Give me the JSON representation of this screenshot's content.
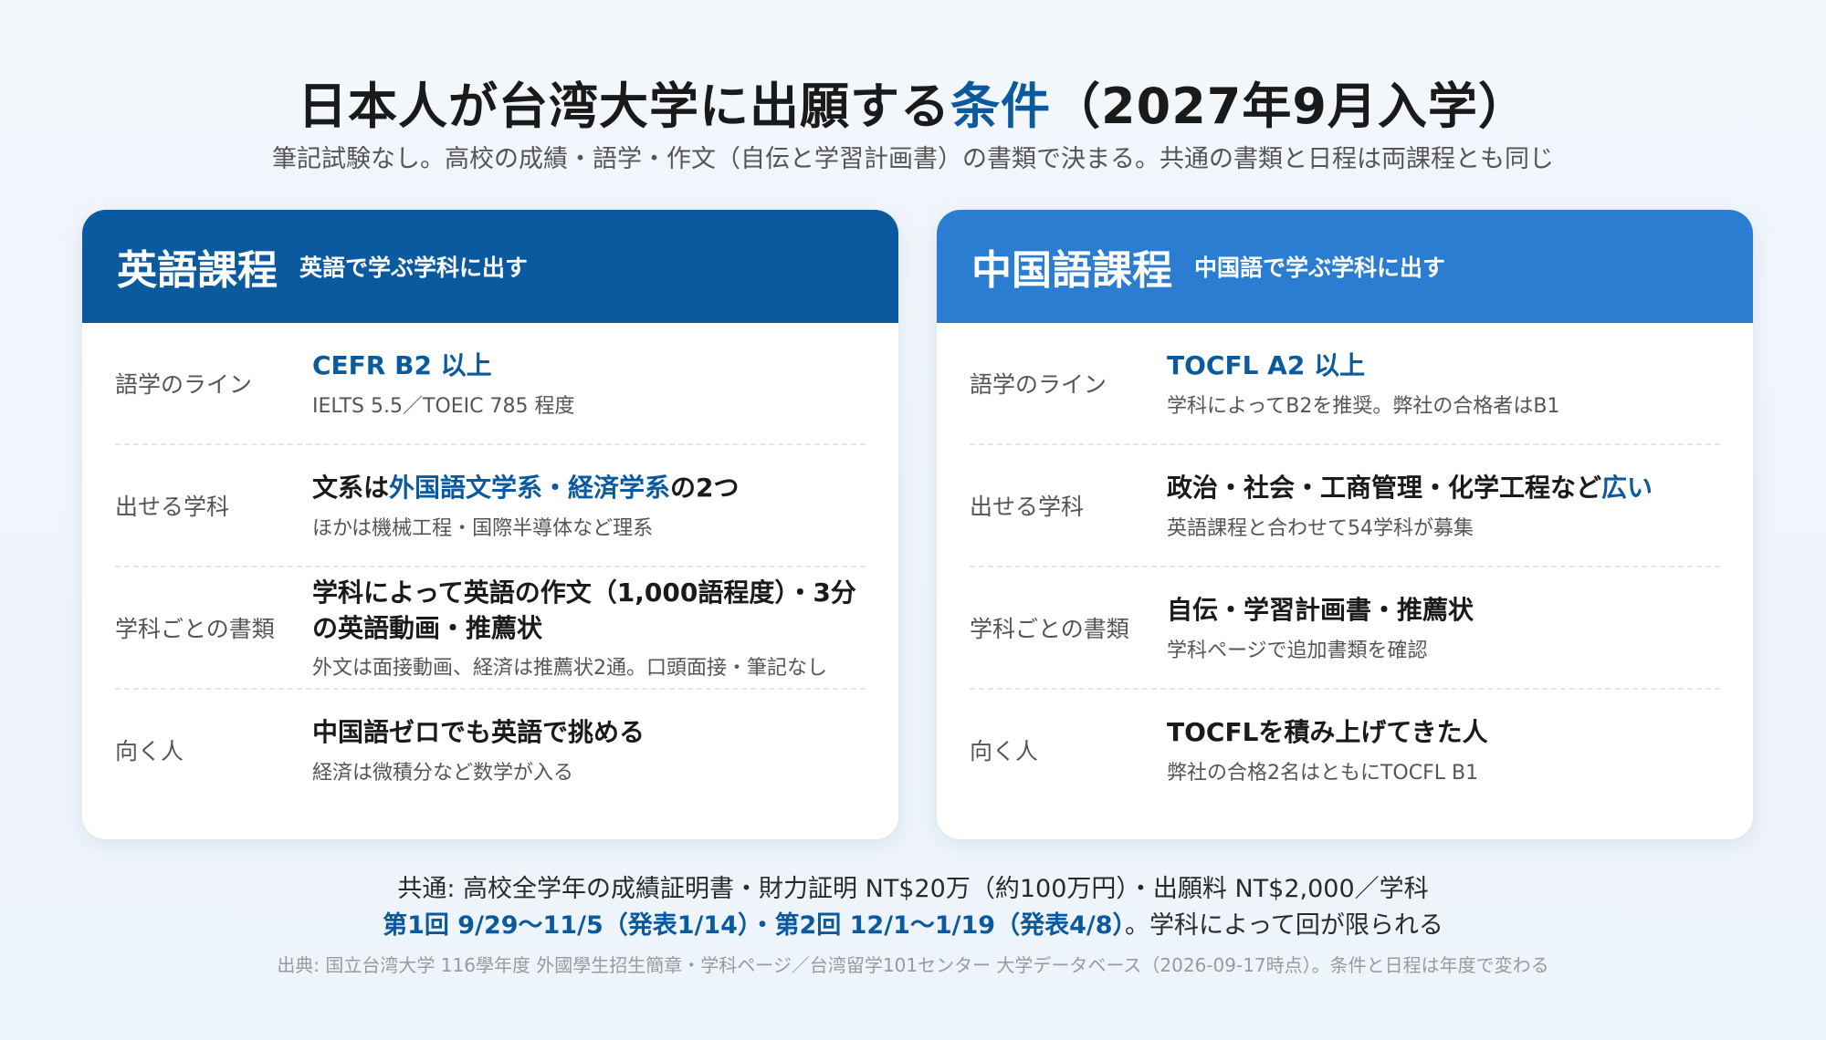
{
  "title": {
    "before": "日本人が台湾大学に出願する",
    "highlight": "条件",
    "after": "（2027年9月入学）"
  },
  "subtitle": "筆記試験なし。高校の成績・語学・作文（自伝と学習計画書）の書類で決まる。共通の書類と日程は両課程とも同じ",
  "colors": {
    "accent": "#0b5aa0",
    "left_header": "#0b5aa0",
    "right_header": "#2a7dd0"
  },
  "english": {
    "title": "英語課程",
    "subtitle": "英語で学ぶ学科に出す",
    "rows": [
      {
        "label": "語学のライン",
        "main": "CEFR B2 以上",
        "note": "IELTS 5.5／TOEIC 785 程度"
      },
      {
        "label": "出せる学科",
        "main_a": "文系は",
        "main_hl": "外国語文学系・経済学系",
        "main_b": "の2つ",
        "note": "ほかは機械工程・国際半導体など理系"
      },
      {
        "label": "学科ごとの書類",
        "main": "学科によって英語の作文（1,000語程度）・3分の英語動画・推薦状",
        "note": "外文は面接動画、経済は推薦状2通。口頭面接・筆記なし"
      },
      {
        "label": "向く人",
        "main": "中国語ゼロでも英語で挑める",
        "note": "経済は微積分など数学が入る"
      }
    ]
  },
  "chinese": {
    "title": "中国語課程",
    "subtitle": "中国語で学ぶ学科に出す",
    "rows": [
      {
        "label": "語学のライン",
        "main": "TOCFL A2 以上",
        "note": "学科によってB2を推奨。弊社の合格者はB1"
      },
      {
        "label": "出せる学科",
        "main_a": "政治・社会・工商管理・化学工程など",
        "main_hl": "広い",
        "note": "英語課程と合わせて54学科が募集"
      },
      {
        "label": "学科ごとの書類",
        "main": "自伝・学習計画書・推薦状",
        "note": "学科ページで追加書類を確認"
      },
      {
        "label": "向く人",
        "main": "TOCFLを積み上げてきた人",
        "note": "弊社の合格2名はともにTOCFL B1"
      }
    ]
  },
  "common": "共通: 高校全学年の成績証明書・財力証明 NT$20万（約100万円）・出願料 NT$2,000／学科",
  "schedule": {
    "highlight": "第1回 9/29〜11/5（発表1/14）・第2回 12/1〜1/19（発表4/8）",
    "rest": "。学科によって回が限られる"
  },
  "source": "出典: 国立台湾大学 116學年度 外國學生招生簡章・学科ページ／台湾留学101センター 大学データベース（2026-09-17時点）。条件と日程は年度で変わる"
}
